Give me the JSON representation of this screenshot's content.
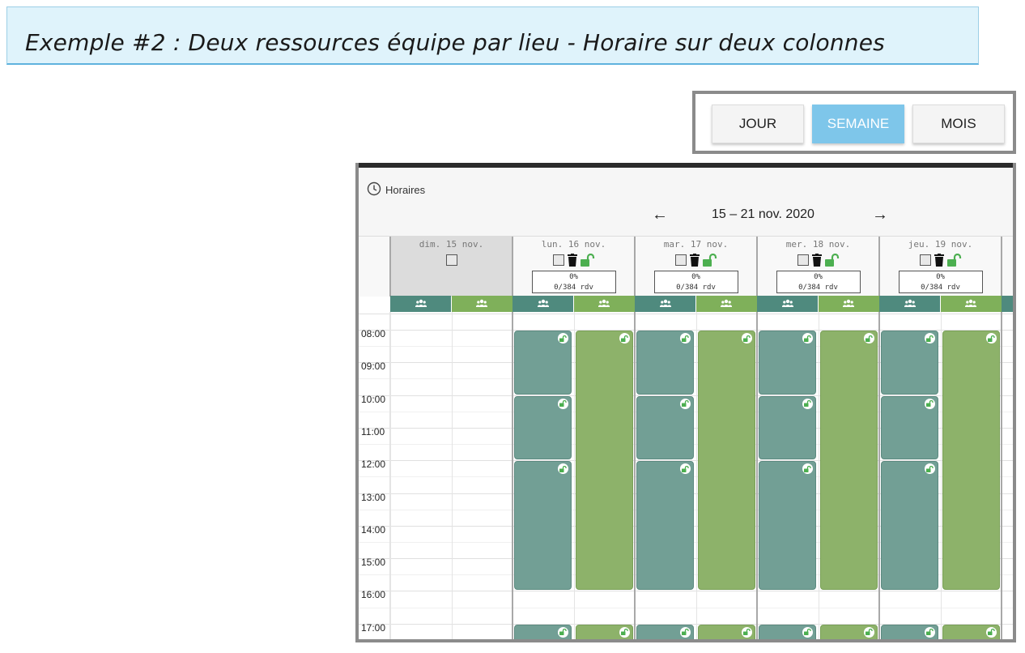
{
  "page_title": "Exemple #2 : Deux ressources équipe par lieu - Horaire sur deux colonnes",
  "view_switch": {
    "day": "JOUR",
    "week": "SEMAINE",
    "month": "MOIS",
    "active": "SEMAINE"
  },
  "calendar": {
    "title": "Horaires",
    "date_range": "15 – 21 nov. 2020",
    "prev_icon": "arrow-left-icon",
    "next_icon": "arrow-right-icon",
    "days": [
      {
        "label": "dim. 15 nov."
      },
      {
        "label": "lun. 16 nov.",
        "percent": "0%",
        "rdv": "0/384 rdv"
      },
      {
        "label": "mar. 17 nov.",
        "percent": "0%",
        "rdv": "0/384 rdv"
      },
      {
        "label": "mer. 18 nov.",
        "percent": "0%",
        "rdv": "0/384 rdv"
      },
      {
        "label": "jeu. 19 nov.",
        "percent": "0%",
        "rdv": "0/384 rdv"
      }
    ],
    "times": [
      "08:00",
      "09:00",
      "10:00",
      "11:00",
      "12:00",
      "13:00",
      "14:00",
      "15:00",
      "16:00",
      "17:00"
    ],
    "colors": {
      "teal": "#729f95",
      "green": "#8db26a",
      "lock": "#4caf50"
    }
  }
}
